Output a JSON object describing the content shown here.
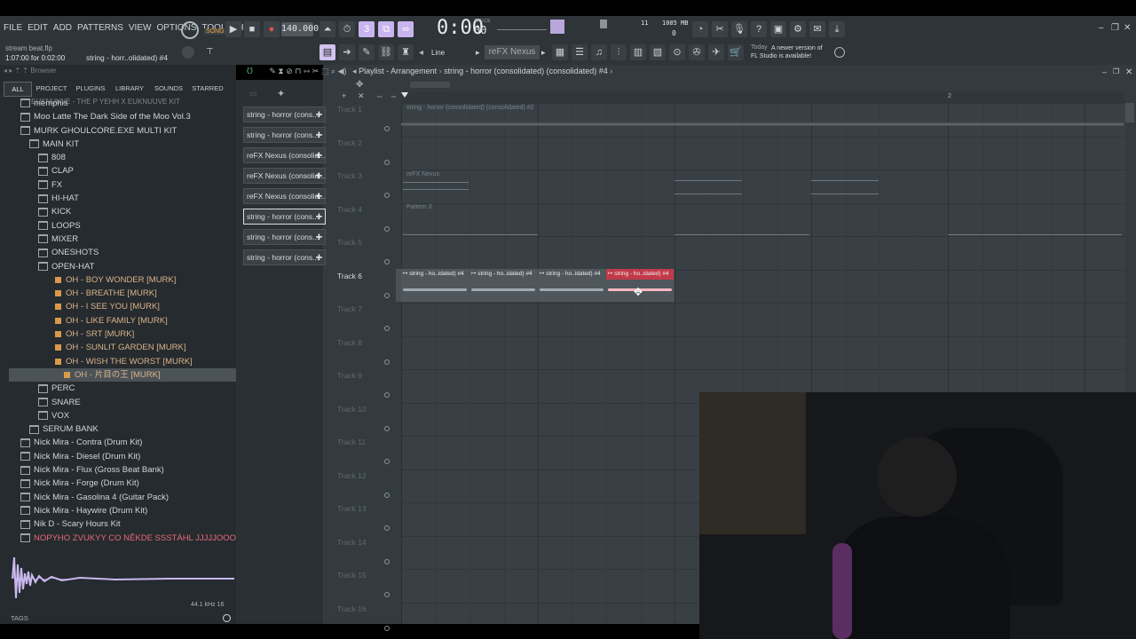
{
  "menu": [
    "FILE",
    "EDIT",
    "ADD",
    "PATTERNS",
    "VIEW",
    "OPTIONS",
    "TOOLS",
    "HELP"
  ],
  "transport": {
    "mode": "SONG",
    "tempo": "140.000",
    "time": "0:00",
    "time_sub": "00",
    "time_label": "M:S:CS",
    "cpu": "11",
    "mem": "1085 MB",
    "poly": "0"
  },
  "project": {
    "file": "stream beat.flp",
    "pattern": "string - horr..olidated) #4",
    "time_info": "1:07:00 for 0:02:00"
  },
  "toolbar": {
    "snap": "Line",
    "plugin": "reFX Nexus",
    "news_day": "Today",
    "news": "A newer version of FL Studio is available!"
  },
  "browser": {
    "title": "Browser",
    "tabs": [
      "ALL",
      "PROJECT",
      "PLUGINS",
      "LIBRARY",
      "SOUNDS",
      "STARRED"
    ],
    "items": [
      {
        "label": "memphis",
        "indent": 1,
        "kind": "folder"
      },
      {
        "label": "Moo Latte The Dark Side of the Moo Vol.3",
        "indent": 1,
        "kind": "folder"
      },
      {
        "label": "MURK GHOULCORE.EXE MULTI KIT",
        "indent": 1,
        "kind": "folder"
      },
      {
        "label": "MAIN KIT",
        "indent": 2,
        "kind": "folder"
      },
      {
        "label": "808",
        "indent": 3,
        "kind": "folder"
      },
      {
        "label": "CLAP",
        "indent": 3,
        "kind": "folder"
      },
      {
        "label": "FX",
        "indent": 3,
        "kind": "folder"
      },
      {
        "label": "HI-HAT",
        "indent": 3,
        "kind": "folder"
      },
      {
        "label": "KICK",
        "indent": 3,
        "kind": "folder"
      },
      {
        "label": "LOOPS",
        "indent": 3,
        "kind": "folder"
      },
      {
        "label": "MIXER",
        "indent": 3,
        "kind": "folder"
      },
      {
        "label": "ONESHOTS",
        "indent": 3,
        "kind": "folder"
      },
      {
        "label": "OPEN-HAT",
        "indent": 3,
        "kind": "folder"
      },
      {
        "label": "OH - BOY WONDER [MURK]",
        "indent": 4,
        "kind": "file"
      },
      {
        "label": "OH - BREATHE [MURK]",
        "indent": 4,
        "kind": "file"
      },
      {
        "label": "OH - I SEE YOU [MURK]",
        "indent": 4,
        "kind": "file"
      },
      {
        "label": "OH - LIKE FAMILY [MURK]",
        "indent": 4,
        "kind": "file"
      },
      {
        "label": "OH - SRT [MURK]",
        "indent": 4,
        "kind": "file"
      },
      {
        "label": "OH - SUNLIT GARDEN [MURK]",
        "indent": 4,
        "kind": "file"
      },
      {
        "label": "OH - WISH THE WORST [MURK]",
        "indent": 4,
        "kind": "file"
      },
      {
        "label": "OH - 片目の王 [MURK]",
        "indent": 5,
        "kind": "file",
        "selected": true
      },
      {
        "label": "PERC",
        "indent": 3,
        "kind": "folder"
      },
      {
        "label": "SNARE",
        "indent": 3,
        "kind": "folder"
      },
      {
        "label": "VOX",
        "indent": 3,
        "kind": "folder"
      },
      {
        "label": "SERUM BANK",
        "indent": 2,
        "kind": "folder"
      },
      {
        "label": "Nick Mira - Contra (Drum Kit)",
        "indent": 1,
        "kind": "folder"
      },
      {
        "label": "Nick Mira - Diesel (Drum Kit)",
        "indent": 1,
        "kind": "folder"
      },
      {
        "label": "Nick Mira - Flux (Gross Beat Bank)",
        "indent": 1,
        "kind": "folder"
      },
      {
        "label": "Nick Mira - Forge (Drum Kit)",
        "indent": 1,
        "kind": "folder"
      },
      {
        "label": "Nick Mira - Gasolina 4 (Guitar Pack)",
        "indent": 1,
        "kind": "folder"
      },
      {
        "label": "Nick Mira - Haywire (Drum Kit)",
        "indent": 1,
        "kind": "folder"
      },
      {
        "label": "Nik D - Scary Hours Kit",
        "indent": 1,
        "kind": "folder"
      },
      {
        "label": "NOPYHO ZVUKYY CO NĚKDE SSSTÁHL JJJJJOOOOO",
        "indent": 1,
        "kind": "folder",
        "accent": true
      }
    ],
    "sample_info": "44.1 kHz 16",
    "tags": "TAGS"
  },
  "playlist": {
    "title": "Playlist - Arrangement",
    "crumb": "string - horror (consolidated) (consolidated) #4",
    "patterns": [
      "string - horror (cons...",
      "string - horror (cons...",
      "reFX Nexus (consolid...",
      "reFX Nexus (consolid...",
      "reFX Nexus (consolid...",
      "string - horror (cons...",
      "string - horror (cons...",
      "string - horror (cons..."
    ],
    "tracks": [
      "Track 1",
      "Track 2",
      "Track 3",
      "Track 4",
      "Track 5",
      "Track 6",
      "Track 7",
      "Track 8",
      "Track 9",
      "Track 10",
      "Track 11",
      "Track 12",
      "Track 13",
      "Track 14",
      "Track 15",
      "Track 16"
    ],
    "bar_mark": "2",
    "clip_track1": "string - horror (consolidated) (consolidated) #2",
    "clip_track3": "reFX Nexus",
    "clip_track4": "Pattern 3",
    "clips_track6": [
      "string - ho..idated) #4",
      "string - ho..idated) #4",
      "string - ho..idated) #4",
      "string - ho..idated) #4"
    ]
  },
  "colors": {
    "accent": "#c8b4ee",
    "selected_clip": "#c23a4a",
    "clip": "#3e464b"
  }
}
